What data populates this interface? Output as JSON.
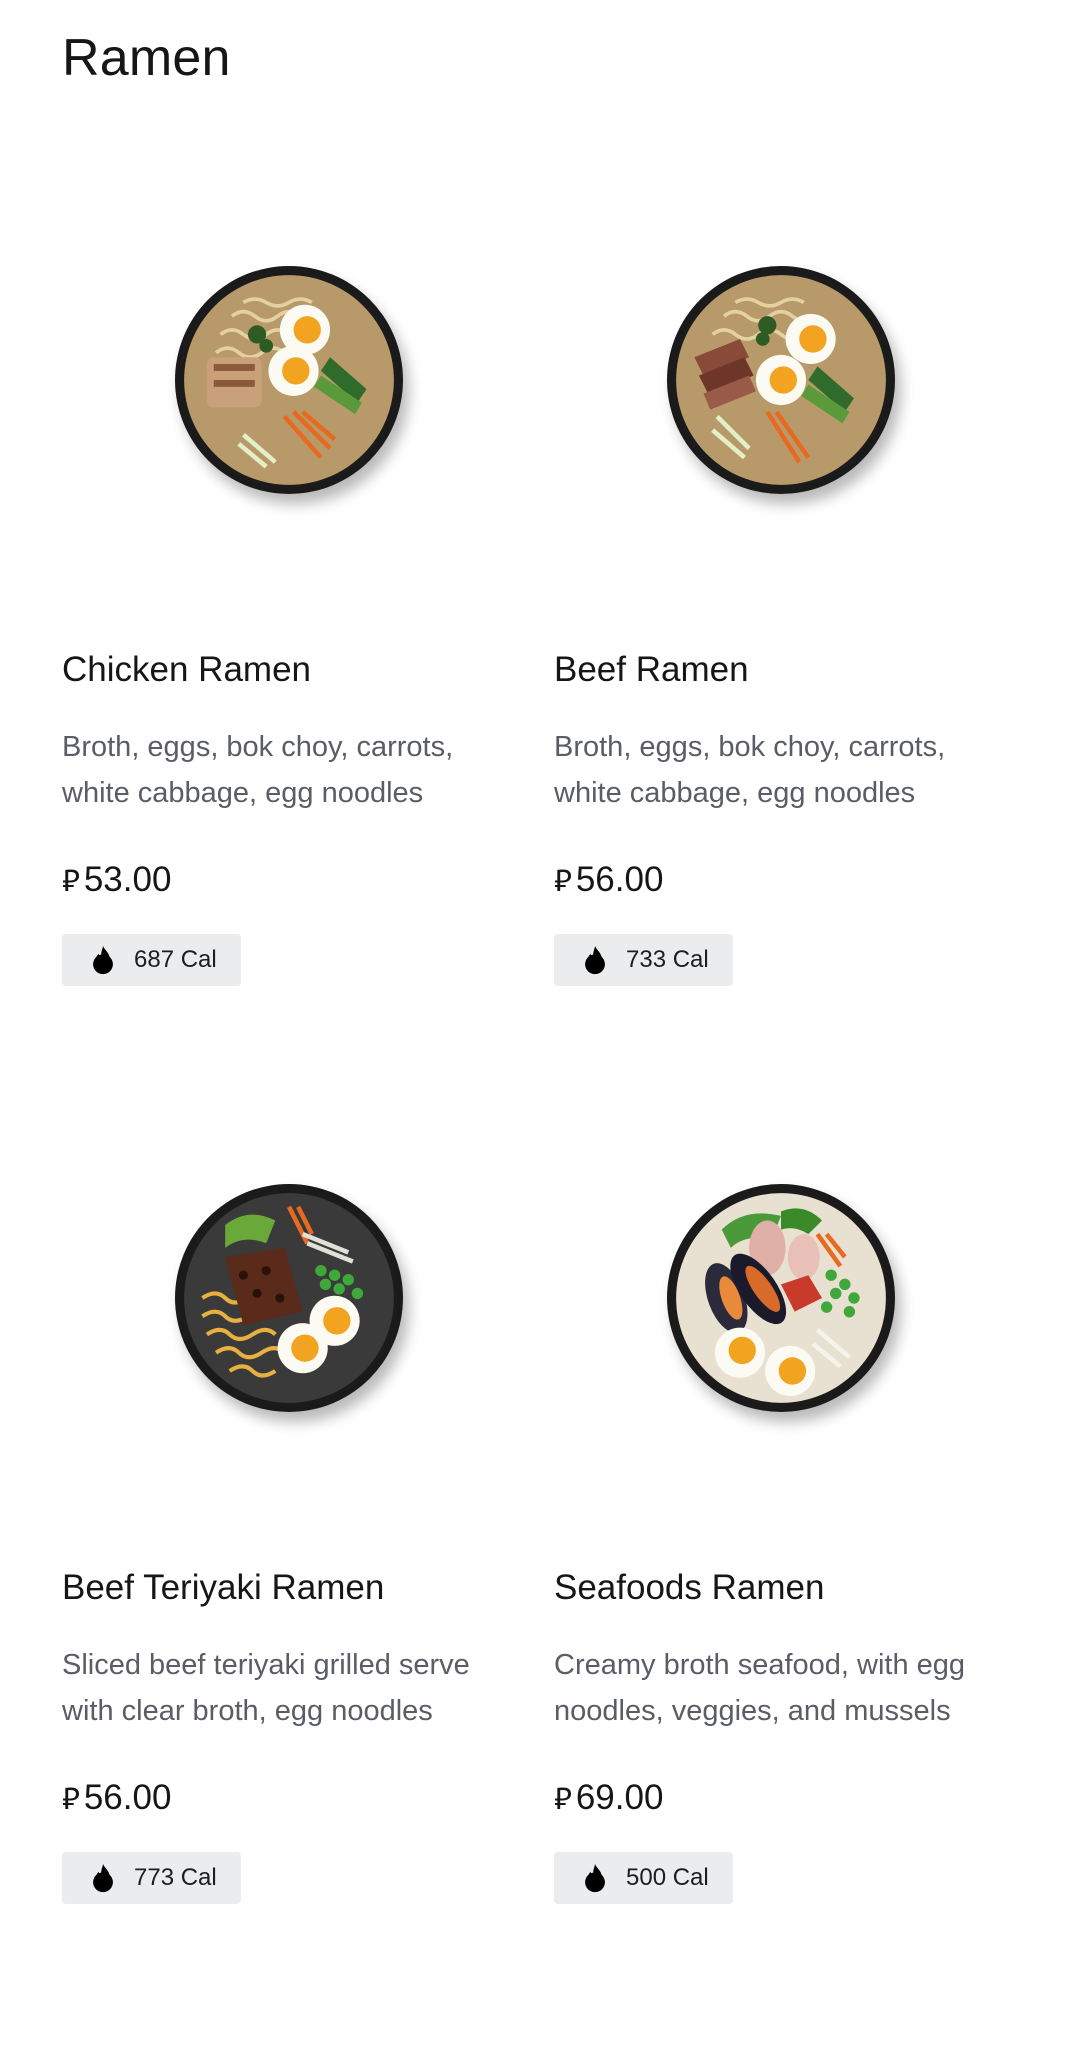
{
  "section": {
    "title": "Ramen"
  },
  "currency_symbol": "⃁",
  "items": [
    {
      "name": "Chicken Ramen",
      "description": "Broth, eggs, bok choy, carrots, white cabbage, egg noodles",
      "price": "53.00",
      "calories": "687 Cal",
      "icon": "chicken-ramen-bowl-image"
    },
    {
      "name": "Beef Ramen",
      "description": "Broth, eggs, bok choy, carrots, white cabbage, egg noodles",
      "price": "56.00",
      "calories": "733 Cal",
      "icon": "beef-ramen-bowl-image"
    },
    {
      "name": "Beef Teriyaki Ramen",
      "description": "Sliced beef teriyaki grilled serve with clear broth, egg noodles",
      "price": "56.00",
      "calories": "773 Cal",
      "icon": "beef-teriyaki-ramen-bowl-image"
    },
    {
      "name": "Seafoods Ramen",
      "description": "Creamy broth seafood, with egg noodles, veggies, and mussels",
      "price": "69.00",
      "calories": "500 Cal",
      "icon": "seafoods-ramen-bowl-image"
    }
  ],
  "colors": {
    "text": "#161616",
    "muted": "#5a5d66",
    "badge_bg": "#ebecee"
  }
}
